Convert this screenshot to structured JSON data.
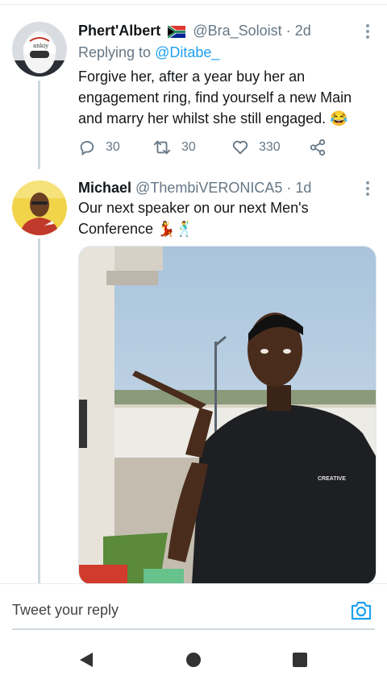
{
  "tweet1": {
    "display_name": "Phert'Albert",
    "handle": "@Bra_Soloist",
    "separator": "·",
    "time": "2d",
    "replying_label": "Replying to",
    "replying_handle": "@Ditabe_",
    "text": "Forgive her, after a year buy her an engagement ring, find yourself a new Main and marry her whilst she still engaged. 😂",
    "flag_icon": "south-africa-flag-icon",
    "avatar_cap_text": "ankiy",
    "replies": "30",
    "retweets": "30",
    "likes": "330"
  },
  "tweet2": {
    "display_name": "Michael",
    "handle": "@ThembiVERONICA5",
    "separator": "·",
    "time": "1d",
    "text": "Our next speaker on our next Men's Conference 💃🕺",
    "media_shirt_text": "CREATIVE"
  },
  "reply": {
    "placeholder": "Tweet your reply"
  },
  "colors": {
    "accent": "#1da1f2",
    "secondary_text": "#657786",
    "thread_line": "#cfd9de"
  }
}
